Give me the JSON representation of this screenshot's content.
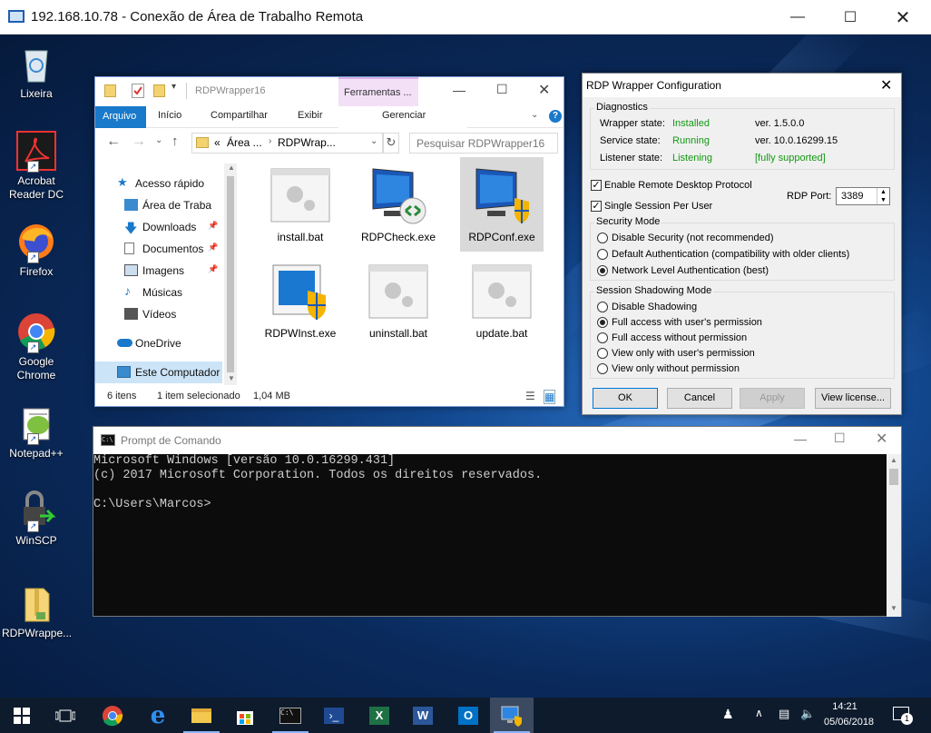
{
  "rdp_window": {
    "title": "192.168.10.78 - Conexão de Área de Trabalho Remota"
  },
  "desktop_icons": [
    {
      "label": "Lixeira",
      "icon": "recycle-bin-icon"
    },
    {
      "label": "Acrobat Reader DC",
      "icon": "acrobat-icon"
    },
    {
      "label": "Firefox",
      "icon": "firefox-icon"
    },
    {
      "label": "Google Chrome",
      "icon": "chrome-icon"
    },
    {
      "label": "Notepad++",
      "icon": "notepadpp-icon"
    },
    {
      "label": "WinSCP",
      "icon": "winscp-icon"
    },
    {
      "label": "RDPWrappe...",
      "icon": "folder-zip-icon"
    }
  ],
  "explorer": {
    "title": "RDPWrapper16",
    "contextual_tab": "Ferramentas ...",
    "ribbon_tabs": {
      "file": "Arquivo",
      "home": "Início",
      "share": "Compartilhar",
      "view": "Exibir",
      "manage": "Gerenciar"
    },
    "address": {
      "prefix": "«",
      "part1": "Área ...",
      "part2": "RDPWrap..."
    },
    "search_placeholder": "Pesquisar RDPWrapper16",
    "nav": {
      "quick": "Acesso rápido",
      "desktop": "Área de Traba",
      "downloads": "Downloads",
      "documents": "Documentos",
      "images": "Imagens",
      "music": "Músicas",
      "videos": "Vídeos",
      "onedrive": "OneDrive",
      "computer": "Este Computador"
    },
    "files": [
      "install.bat",
      "RDPCheck.exe",
      "RDPConf.exe",
      "RDPWInst.exe",
      "uninstall.bat",
      "update.bat"
    ],
    "status": {
      "items": "6 itens",
      "selected": "1 item selecionado",
      "size": "1,04 MB"
    }
  },
  "rdpconf": {
    "title": "RDP Wrapper Configuration",
    "diagnostics": {
      "title": "Diagnostics",
      "wrapper_label": "Wrapper state:",
      "wrapper_value": "Installed",
      "wrapper_ver": "ver. 1.5.0.0",
      "service_label": "Service state:",
      "service_value": "Running",
      "service_ver": "ver. 10.0.16299.15",
      "listener_label": "Listener state:",
      "listener_value": "Listening",
      "listener_support": "[fully supported]"
    },
    "enable_rdp": "Enable Remote Desktop Protocol",
    "single_session": "Single Session Per User",
    "port_label": "RDP Port:",
    "port_value": "3389",
    "security": {
      "title": "Security Mode",
      "opt1": "Disable Security (not recommended)",
      "opt2": "Default Authentication (compatibility with older clients)",
      "opt3": "Network Level Authentication (best)"
    },
    "shadow": {
      "title": "Session Shadowing Mode",
      "opt1": "Disable Shadowing",
      "opt2": "Full access with user's permission",
      "opt3": "Full access without permission",
      "opt4": "View only with user's permission",
      "opt5": "View only without permission"
    },
    "buttons": {
      "ok": "OK",
      "cancel": "Cancel",
      "apply": "Apply",
      "license": "View license..."
    }
  },
  "cmd": {
    "title": "Prompt de Comando",
    "line1": "Microsoft Windows [versão 10.0.16299.431]",
    "line2": "(c) 2017 Microsoft Corporation. Todos os direitos reservados.",
    "line3": "",
    "line4": "C:\\Users\\Marcos>"
  },
  "taskbar": {
    "time": "14:21",
    "date": "05/06/2018",
    "notification_count": "1"
  }
}
